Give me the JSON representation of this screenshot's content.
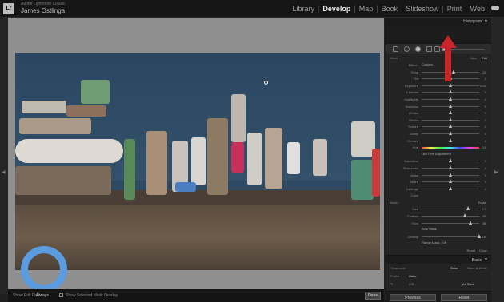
{
  "app": {
    "brand_line": "Adobe Lightroom Classic",
    "user_name": "James Ostlinga"
  },
  "modules": [
    "Library",
    "Develop",
    "Map",
    "Book",
    "Slideshow",
    "Print",
    "Web"
  ],
  "active_module": "Develop",
  "bottom_bar": {
    "show_edit_pins_label": "Show Edit Pins :",
    "show_edit_pins_value": "Always",
    "overlay_label": "Show Selected Mask Overlay",
    "done_label": "Done"
  },
  "right_panel": {
    "histogram_title": "Histogram",
    "mask_label": "Mask :",
    "mask_new": "New",
    "mask_edit": "Edit",
    "effect_label": "Effect :",
    "effect_value": "Custom",
    "sliders": [
      {
        "label": "Temp",
        "pos": 0.55,
        "value": "-23"
      },
      {
        "label": "Tint",
        "pos": 0.5,
        "value": "0"
      },
      {
        "label": "Exposure",
        "pos": 0.5,
        "value": "0.00"
      },
      {
        "label": "Contrast",
        "pos": 0.5,
        "value": "0"
      },
      {
        "label": "Highlights",
        "pos": 0.5,
        "value": "0"
      },
      {
        "label": "Shadows",
        "pos": 0.5,
        "value": "0"
      },
      {
        "label": "Whites",
        "pos": 0.5,
        "value": "0"
      },
      {
        "label": "Blacks",
        "pos": 0.5,
        "value": "0"
      },
      {
        "label": "Texture",
        "pos": 0.5,
        "value": "0"
      },
      {
        "label": "Clarity",
        "pos": 0.5,
        "value": "0"
      },
      {
        "label": "Dehaze",
        "pos": 0.5,
        "value": "0"
      }
    ],
    "hue_label": "Hue",
    "hue_value": "0.0",
    "use_fine_adjustment": "Use Fine Adjustment",
    "sliders2": [
      {
        "label": "Saturation",
        "pos": 0.5,
        "value": "0"
      },
      {
        "label": "Sharpness",
        "pos": 0.5,
        "value": "0"
      },
      {
        "label": "Noise",
        "pos": 0.5,
        "value": "0"
      },
      {
        "label": "Moiré",
        "pos": 0.5,
        "value": "0"
      },
      {
        "label": "Defringe",
        "pos": 0.5,
        "value": "0"
      }
    ],
    "color_label": "Color",
    "brush_label": "Brush :",
    "brush_erase": "Erase",
    "brush_sliders": [
      {
        "label": "Size",
        "pos": 0.8,
        "value": "7.0"
      },
      {
        "label": "Feather",
        "pos": 0.75,
        "value": "80"
      },
      {
        "label": "Flow",
        "pos": 0.85,
        "value": "80"
      }
    ],
    "auto_mask": "Auto Mask",
    "density": {
      "label": "Density",
      "pos": 1.0,
      "value": "100"
    },
    "range_mask_label": "Range Mask : Off",
    "reset_label": "Reset",
    "close_label": "Close",
    "basic_title": "Basic",
    "treatment_label": "Treatment :",
    "treatment_color": "Color",
    "treatment_bw": "Black & White",
    "profile_label": "Profile :",
    "profile_value": "Color",
    "wb_label": "WB :",
    "wb_value": "As Shot",
    "previous_label": "Previous",
    "reset_button": "Reset"
  }
}
